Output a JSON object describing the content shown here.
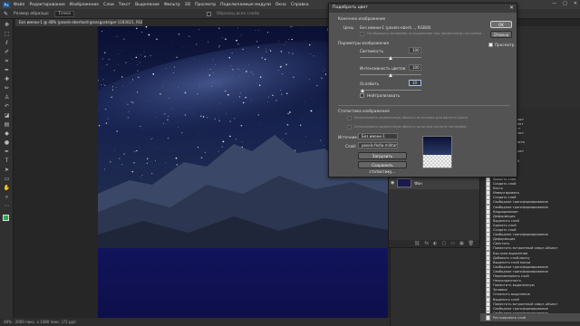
{
  "menubar": {
    "logo": "Ps",
    "items": [
      "Файл",
      "Редактирование",
      "Изображение",
      "Слои",
      "Текст",
      "Выделение",
      "Фильтр",
      "3D",
      "Просмотр",
      "Подключаемые модули",
      "Окно",
      "Справка"
    ],
    "minimize": "—",
    "maximize": "□",
    "close": "✕"
  },
  "optbar": {
    "size_label": "Размер образца:",
    "size_value": "Точка",
    "sample_label": "Образец всех слоёв"
  },
  "document": {
    "tab_title": "Без имени-1 @ 48% (pexels-eberhard-grossgasteiger-1183021, RGB/8) *",
    "status": "48% · 2000 пикс. x 1480 пикс. (72 ppi)"
  },
  "layers": {
    "layer_name": "Фон",
    "footer_icons": [
      "fx",
      "◐",
      "▢",
      "▭",
      "▣",
      "🗑"
    ]
  },
  "history": {
    "items": [
      "Автоподбор",
      "Яркость/контраст",
      "Выделить объект",
      "Удалить объект",
      "Яркость/контраст",
      "Создать слой",
      "Выделить область",
      "Инверсия",
      "Яркость/контраст",
      "Слой/нов.",
      "Выделить слой",
      "Яркость слоя",
      "Яркость слоя",
      "Яркость слоя",
      "Яркость слоя",
      "Создать слой",
      "Кисть",
      "Инвертировать",
      "Создать слой",
      "Свободное трансформирование",
      "Свободное трансформирование",
      "Кадрирование",
      "Деформация",
      "Выделить слой",
      "Удалить слой",
      "Создать слой",
      "Свободное трансформирование",
      "Деформация",
      "Сместить",
      "Поместить встроенный смарт-объект",
      "Быстрое выделение",
      "Добавить слой-маску",
      "Выделить слой маски",
      "Свободное трансформирование",
      "Свободное трансформирование",
      "Переименовать слой",
      "Непрозрачность",
      "Поместить выделенную",
      "Заливка",
      "Отменить выделение",
      "Выделить слой",
      "Поместить встроенный смарт-объект",
      "Свободное трансформирование",
      "Свободное трансформирование",
      "Растрировать слой"
    ]
  },
  "dialog": {
    "title": "Подобрать цвет",
    "close": "✕",
    "target_section": "Конечное изображение",
    "target_label": "Цель:",
    "target_value": "Без имени-1 (pexels-eberh..., RGB/8)",
    "ignore_selection": "Не обращать внимания на выделение при применении настройки",
    "options_section": "Параметры изображения",
    "luminance_label": "Светимость",
    "luminance_value": "100",
    "intensity_label": "Интенсивность цветов",
    "intensity_value": "100",
    "fade_label": "Ослабить",
    "fade_value": "10",
    "neutralize_label": "Нейтрализовать",
    "stats_section": "Статистика изображения",
    "use_sel_source": "Использовать выделенную область источника для расчета цвета",
    "use_sel_target": "Использовать выделенную область цели для расчета настройки",
    "source_label": "Источник:",
    "source_value": "Без имени-1",
    "layer_label": "Слой:",
    "layer_value": "pexels-fedia-mihtam...",
    "load_stats": "Загрузить статистику...",
    "save_stats": "Сохранить статистику...",
    "ok": "OK",
    "cancel": "Отмена",
    "preview_label": "Просмотр",
    "sliders": {
      "luminance": 100,
      "intensity": 100,
      "fade": 10,
      "max": 200
    }
  },
  "toolbar": {
    "icons": [
      "move-icon",
      "marquee-icon",
      "lasso-icon",
      "quick-select-icon",
      "crop-icon",
      "eyedropper-icon",
      "healing-icon",
      "brush-icon",
      "stamp-icon",
      "history-brush-icon",
      "eraser-icon",
      "gradient-icon",
      "blur-icon",
      "dodge-icon",
      "pen-icon",
      "type-icon",
      "path-select-icon",
      "shape-icon",
      "hand-icon",
      "zoom-icon",
      "more-icon"
    ],
    "fg_color": "#2fa84f",
    "bg_color": "#e8e8e8"
  }
}
